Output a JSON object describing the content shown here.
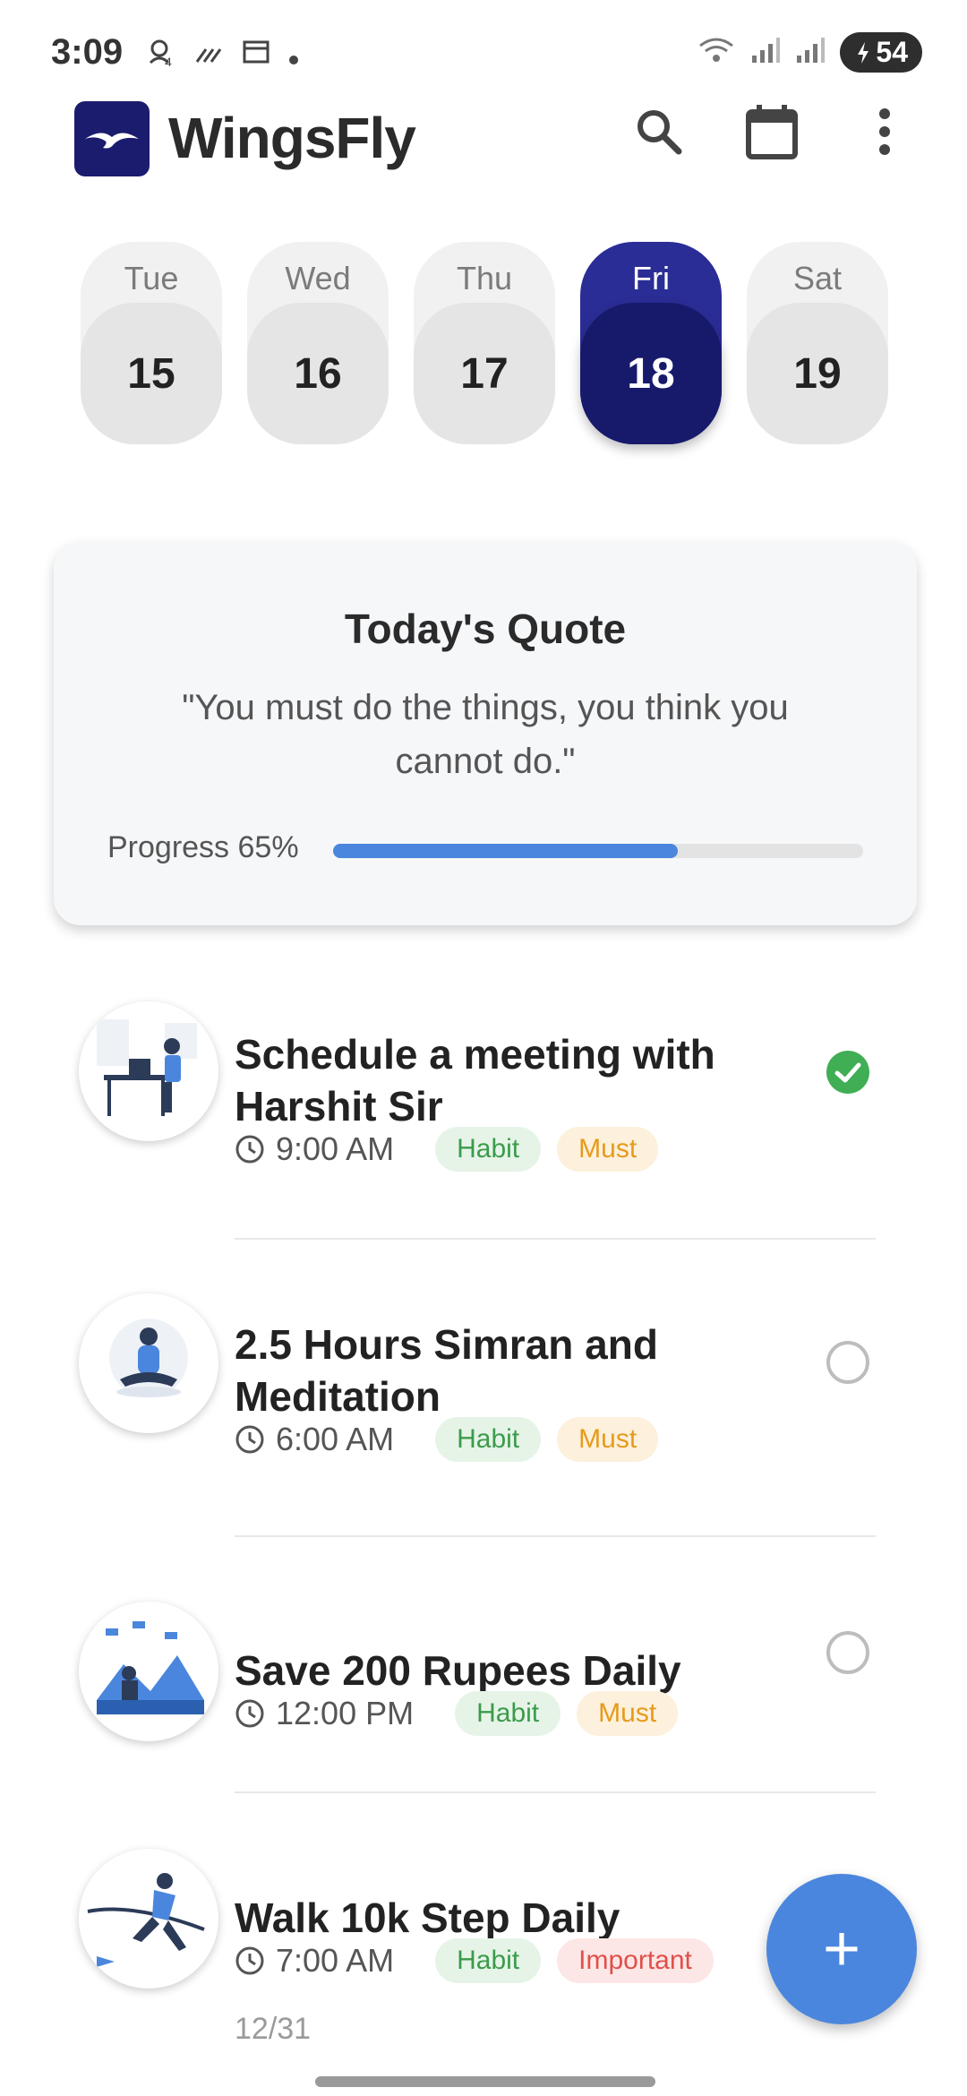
{
  "status_bar": {
    "time": "3:09",
    "battery": "54",
    "left_icons": [
      "notification-icon",
      "signal-activity-icon",
      "calendar-icon",
      "dot-icon"
    ],
    "right_icons": [
      "wifi-icon",
      "cell-signal-icon",
      "cell-signal-icon",
      "battery-icon"
    ]
  },
  "app": {
    "title": "WingsFly",
    "actions": [
      "search-icon",
      "calendar-icon",
      "more-vert-icon"
    ]
  },
  "calendar": {
    "days": [
      {
        "dow": "Tue",
        "num": "15",
        "selected": false
      },
      {
        "dow": "Wed",
        "num": "16",
        "selected": false
      },
      {
        "dow": "Thu",
        "num": "17",
        "selected": false
      },
      {
        "dow": "Fri",
        "num": "18",
        "selected": true
      },
      {
        "dow": "Sat",
        "num": "19",
        "selected": false
      }
    ]
  },
  "quote": {
    "title": "Today's Quote",
    "text": "\"You must do the things, you think you cannot do.\"",
    "progress_label": "Progress 65%",
    "progress_value": 0.65
  },
  "tasks": [
    {
      "title": "Schedule a meeting with Harshit Sir",
      "time": "9:00 AM",
      "tags": [
        "Habit",
        "Must"
      ],
      "done": true
    },
    {
      "title": "2.5 Hours Simran and Meditation",
      "time": "6:00 AM",
      "tags": [
        "Habit",
        "Must"
      ],
      "done": false
    },
    {
      "title": "Save 200 Rupees Daily",
      "time": "12:00 PM",
      "tags": [
        "Habit",
        "Must"
      ],
      "done": false
    },
    {
      "title": "Walk 10k Step Daily",
      "time": "7:00 AM",
      "tags": [
        "Habit",
        "Important"
      ],
      "done": false,
      "count": "12/31"
    }
  ],
  "fab": {
    "label": "+"
  },
  "colors": {
    "accent": "#4a86dd",
    "selected_day": "#171a6b",
    "habit": "#3b9b4b",
    "must": "#e59b1d",
    "important": "#e0504a",
    "done": "#3fae54"
  }
}
